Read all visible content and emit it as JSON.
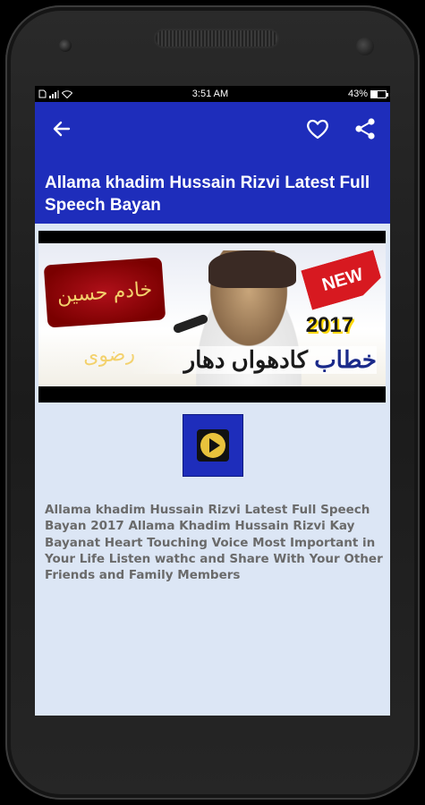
{
  "status_bar": {
    "time": "3:51 AM",
    "battery_percent": "43%",
    "battery_level": 0.43
  },
  "app_bar": {
    "back_icon": "arrow-left-icon",
    "favorite_icon": "heart-outline-icon",
    "share_icon": "share-icon",
    "title": "Allama khadim Hussain Rizvi Latest Full Speech Bayan"
  },
  "banner": {
    "badge_text": "خادم حسین رضوی",
    "new_label": "NEW",
    "year": "2017",
    "urdu_caption_a": "کادھواں دھار",
    "urdu_caption_b": "خطاب"
  },
  "player": {
    "play_icon": "play-icon"
  },
  "description": "Allama khadim Hussain Rizvi Latest Full Speech Bayan 2017 Allama Khadim Hussain Rizvi Kay Bayanat Heart Touching Voice Most Important in Your Life Listen wathc and Share With Your Other Friends and Family Members",
  "colors": {
    "app_bar": "#1e2dbb",
    "content_bg": "#dce6f5",
    "description_text": "#6a6a6a"
  }
}
